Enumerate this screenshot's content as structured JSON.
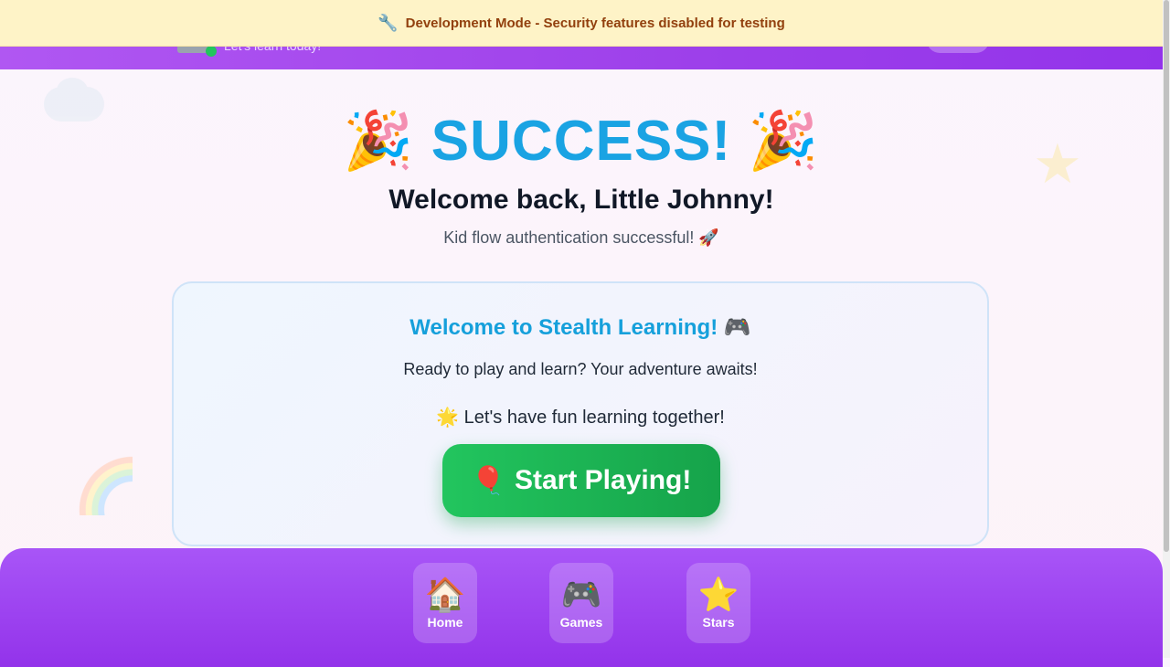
{
  "banner": {
    "icon": "🔧",
    "text": "Development Mode - Security features disabled for testing"
  },
  "header": {
    "subtitle": "Let's learn today!"
  },
  "success": {
    "title": "SUCCESS!",
    "left_emoji": "🎉",
    "right_emoji": "🎉"
  },
  "welcome": {
    "heading": "Welcome back, Little Johnny!",
    "subtitle": "Kid flow authentication successful! 🚀"
  },
  "card": {
    "title": "Welcome to Stealth Learning! 🎮",
    "text": "Ready to play and learn? Your adventure awaits!",
    "fun_text": "🌟 Let's have fun learning together!",
    "start_icon": "🎈",
    "start_label": "Start Playing!"
  },
  "nav": {
    "items": [
      {
        "icon": "🏠",
        "label": "Home"
      },
      {
        "icon": "🎮",
        "label": "Games"
      },
      {
        "icon": "⭐",
        "label": "Stars"
      }
    ]
  },
  "colors": {
    "accent": "#1aa3e3",
    "purple": "#9333ea",
    "green": "#22c55e",
    "banner_bg": "#fef3c7",
    "banner_text": "#92400e"
  }
}
